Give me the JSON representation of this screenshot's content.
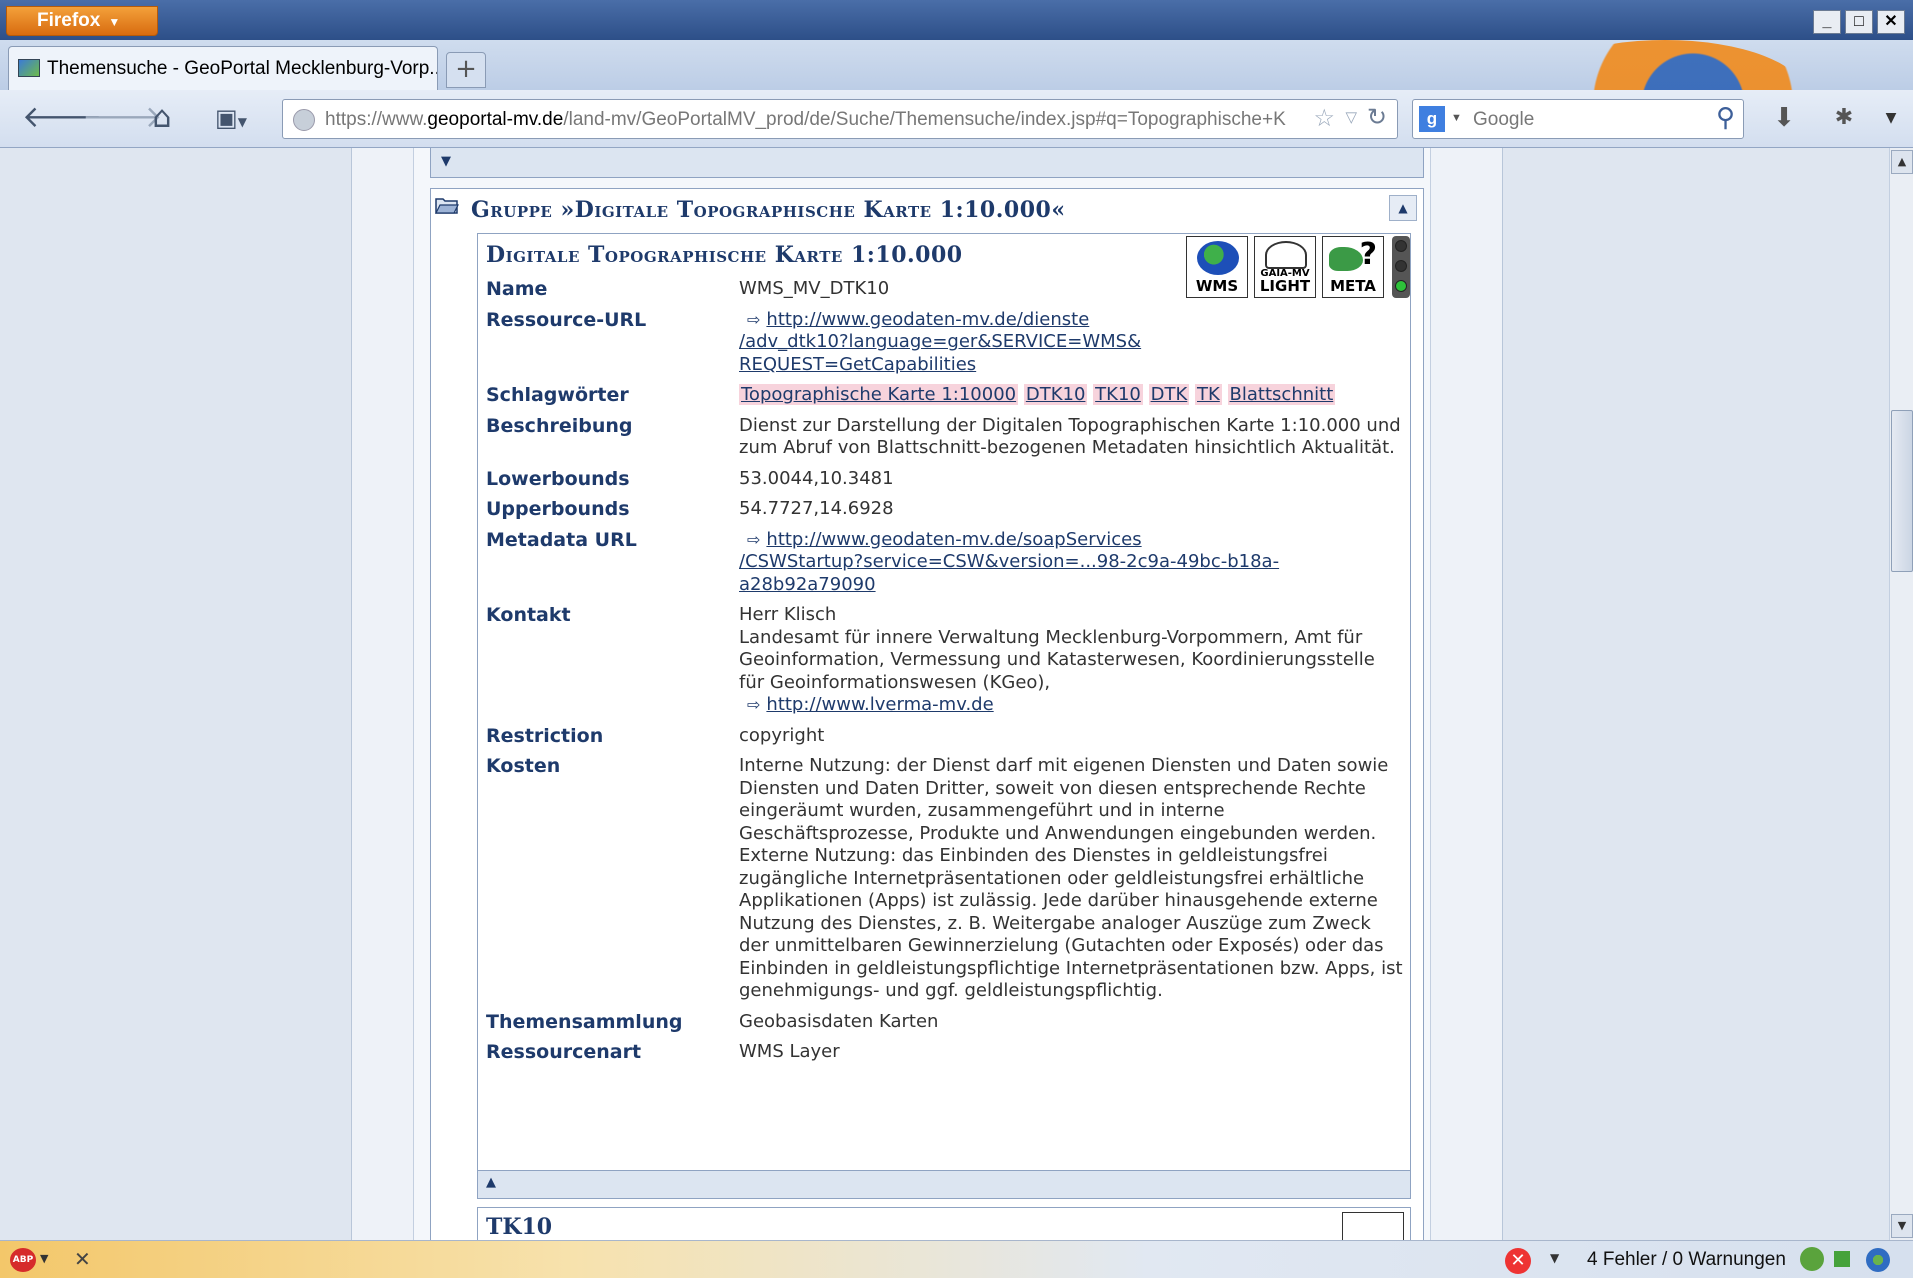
{
  "window": {
    "menu_label": "Firefox",
    "controls": [
      "_",
      "□",
      "✕"
    ]
  },
  "tab": {
    "title": "Themensuche - GeoPortal Mecklenburg-Vorp...",
    "new_tab": "+"
  },
  "nav": {
    "url_prefix": "https://www.",
    "url_domain": "geoportal-mv.de",
    "url_path": "/land-mv/GeoPortalMV_prod/de/Suche/Themensuche/index.jsp#q=Topographische+K",
    "search_placeholder": "Google",
    "search_engine_icon": "g-icon"
  },
  "group": {
    "title": "Gruppe »Digitale Topographische Karte 1:10.000«"
  },
  "record": {
    "title": "Digitale Topographische Karte 1:10.000",
    "badges": [
      {
        "name": "wms-badge",
        "label": "WMS"
      },
      {
        "name": "gaia-light-badge",
        "small": "GAIA-MV",
        "label": "LIGHT"
      },
      {
        "name": "meta-badge",
        "label": "META"
      }
    ],
    "fields": {
      "name": {
        "key": "Name",
        "value": "WMS_MV_DTK10"
      },
      "resource_url": {
        "key": "Ressource-URL",
        "line1": "http://www.geodaten-mv.de/dienste",
        "line2": "/adv_dtk10?language=ger&SERVICE=WMS&",
        "line3": "REQUEST=GetCapabilities"
      },
      "keywords": {
        "key": "Schlagwörter",
        "tags": [
          "Topographische Karte 1:10000",
          "DTK10",
          "TK10",
          "DTK",
          "TK",
          "Blattschnitt"
        ]
      },
      "description": {
        "key": "Beschreibung",
        "value": "Dienst zur Darstellung der Digitalen Topographischen Karte 1:10.000 und zum Abruf von Blattschnitt-bezogenen Metadaten hinsichtlich Aktualität."
      },
      "lowerbounds": {
        "key": "Lowerbounds",
        "value": "53.0044,10.3481"
      },
      "upperbounds": {
        "key": "Upperbounds",
        "value": "54.7727,14.6928"
      },
      "metadata_url": {
        "key": "Metadata URL",
        "line1": "http://www.geodaten-mv.de/soapServices",
        "line2": "/CSWStartup?service=CSW&version=...98-2c9a-49bc-b18a-",
        "line3": "a28b92a79090"
      },
      "contact": {
        "key": "Kontakt",
        "person": "Herr Klisch",
        "org": "Landesamt für innere Verwaltung Mecklenburg-Vorpommern, Amt für Geoinformation, Vermessung und Katasterwesen, Koordinierungsstelle für Geoinformationswesen (KGeo),",
        "link": "http://www.lverma-mv.de"
      },
      "restriction": {
        "key": "Restriction",
        "value": "copyright"
      },
      "costs": {
        "key": "Kosten",
        "value": "Interne Nutzung: der Dienst darf mit eigenen Diensten und Daten sowie Diensten und Daten Dritter, soweit von diesen entsprechende Rechte eingeräumt wurden, zusammengeführt und in interne Geschäftsprozesse, Produkte und Anwendungen eingebunden werden. Externe Nutzung: das Einbinden des Dienstes in geldleistungsfrei zugängliche Internetpräsentationen oder geldleistungsfrei erhältliche Applikationen (Apps) ist zulässig. Jede darüber hinausgehende externe Nutzung des Dienstes, z. B. Weitergabe analoger Auszüge zum Zweck der unmittelbaren Gewinnerzielung (Gutachten oder Exposés) oder das Einbinden in geldleistungspflichtige Internetpräsentationen bzw. Apps, ist genehmigungs- und ggf. geldleistungspflichtig."
      },
      "collection": {
        "key": "Themensammlung",
        "value": "Geobasisdaten Karten"
      },
      "resource_type": {
        "key": "Ressourcenart",
        "value": "WMS Layer"
      }
    }
  },
  "next_record": {
    "title": "TK10"
  },
  "status": {
    "errors": "4 Fehler / 0 Warnungen",
    "abp": "ABP"
  },
  "colors": {
    "accent": "#1e3a6b",
    "tag_bg": "#f7d3dc",
    "titlebar": "#2d4f88"
  }
}
